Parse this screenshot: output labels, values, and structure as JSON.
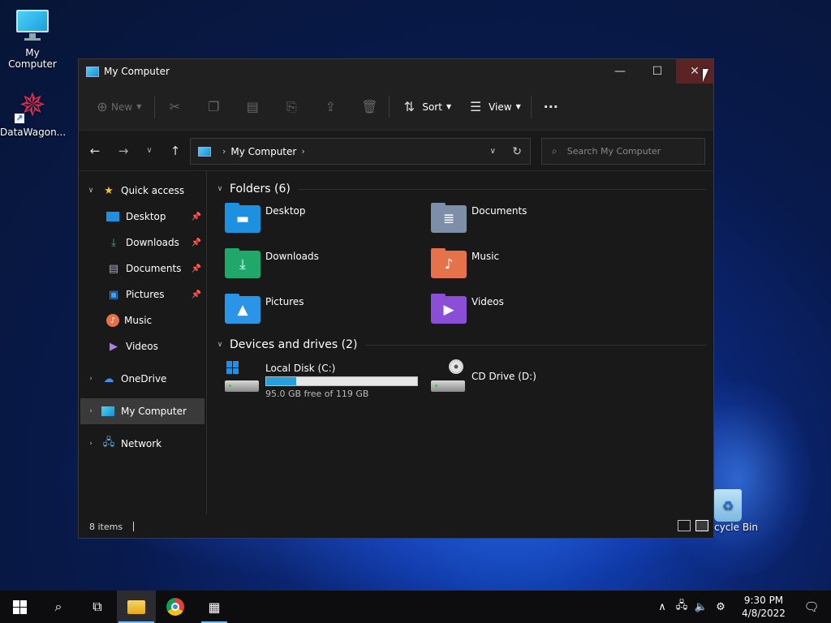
{
  "desktop": {
    "icons": [
      {
        "label": "My Computer"
      },
      {
        "label": "DataWagon..."
      }
    ],
    "recycle_bin_label": "cycle Bin"
  },
  "window": {
    "title": "My Computer",
    "controls": {
      "minimize": "—",
      "maximize": "☐",
      "close": "✕"
    }
  },
  "command_bar": {
    "new_label": "New",
    "sort_label": "Sort",
    "view_label": "View",
    "more_label": "···"
  },
  "address_bar": {
    "crumb": "My Computer",
    "search_placeholder": "Search My Computer"
  },
  "sidebar": {
    "quick_access": "Quick access",
    "pinned": [
      {
        "label": "Desktop"
      },
      {
        "label": "Downloads"
      },
      {
        "label": "Documents"
      },
      {
        "label": "Pictures"
      },
      {
        "label": "Music"
      },
      {
        "label": "Videos"
      }
    ],
    "onedrive": "OneDrive",
    "my_computer": "My Computer",
    "network": "Network"
  },
  "content": {
    "folders_header": "Folders (6)",
    "folders": [
      {
        "label": "Desktop",
        "color": "#1e90e0"
      },
      {
        "label": "Documents",
        "color": "#7d8fa8"
      },
      {
        "label": "Downloads",
        "color": "#1fa86a"
      },
      {
        "label": "Music",
        "color": "#e5724a"
      },
      {
        "label": "Pictures",
        "color": "#2a94e6"
      },
      {
        "label": "Videos",
        "color": "#8a4fd6"
      }
    ],
    "devices_header": "Devices and drives (2)",
    "drives": [
      {
        "label": "Local Disk (C:)",
        "free_text": "95.0 GB free of 119 GB",
        "used_fraction": 0.2
      },
      {
        "label": "CD Drive (D:)"
      }
    ]
  },
  "status_bar": {
    "item_count": "8 items"
  },
  "taskbar": {
    "time": "9:30 PM",
    "date": "4/8/2022"
  }
}
